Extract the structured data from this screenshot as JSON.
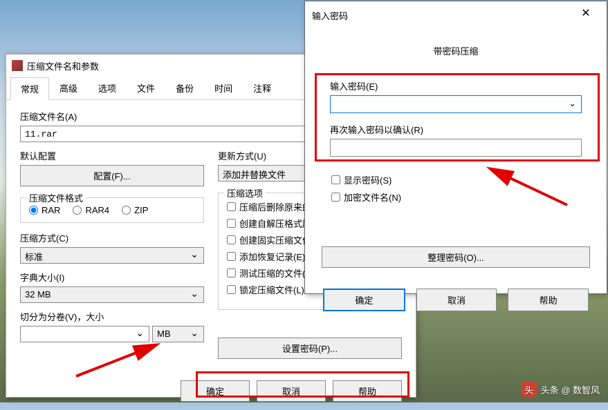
{
  "dialog1": {
    "title": "压缩文件名和参数",
    "tabs": [
      "常规",
      "高级",
      "选项",
      "文件",
      "备份",
      "时间",
      "注释"
    ],
    "filename_label": "压缩文件名(A)",
    "filename_value": "11.rar",
    "default_profile_label": "默认配置",
    "profile_button": "配置(F)...",
    "format_label": "压缩文件格式",
    "format_options": [
      "RAR",
      "RAR4",
      "ZIP"
    ],
    "format_selected": "RAR",
    "method_label": "压缩方式(C)",
    "method_value": "标准",
    "dict_label": "字典大小(I)",
    "dict_value": "32 MB",
    "split_label": "切分为分卷(V)，大小",
    "split_unit": "MB",
    "update_label": "更新方式(U)",
    "update_value": "添加并替换文件",
    "options_label": "压缩选项",
    "options": [
      "压缩后删除原来的文件",
      "创建自解压格式压缩文件",
      "创建固实压缩文件(S)",
      "添加恢复记录(E)",
      "测试压缩的文件(T)",
      "锁定压缩文件(L)"
    ],
    "set_password_button": "设置密码(P)...",
    "ok": "确定",
    "cancel": "取消",
    "help": "帮助"
  },
  "dialog2": {
    "title": "输入密码",
    "subtitle": "带密码压缩",
    "enter_label": "输入密码(E)",
    "confirm_label": "再次输入密码以确认(R)",
    "show_password": "显示密码(S)",
    "encrypt_names": "加密文件名(N)",
    "organize": "整理密码(O)...",
    "ok": "确定",
    "cancel": "取消",
    "help": "帮助"
  },
  "watermark": "头条 @ 数智风"
}
